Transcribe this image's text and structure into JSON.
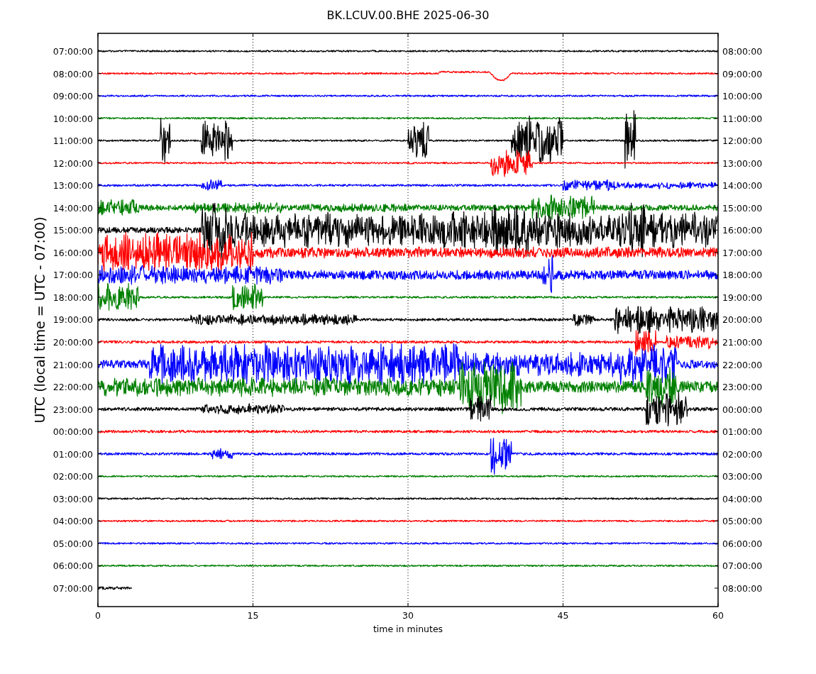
{
  "title": "BK.LCUV.00.BHE 2025-06-30",
  "ylabel": "UTC (local time = UTC - 07:00)",
  "xlabel": "time in minutes",
  "xticks": [
    "0",
    "15",
    "30",
    "45",
    "60"
  ],
  "traces": [
    {
      "left_label": "07:00:00",
      "right_label": "08:00:00",
      "color": "#000000",
      "level": 1
    },
    {
      "left_label": "08:00:00",
      "right_label": "09:00:00",
      "color": "#ff0000",
      "level": 1
    },
    {
      "left_label": "09:00:00",
      "right_label": "10:00:00",
      "color": "#0000ff",
      "level": 1
    },
    {
      "left_label": "10:00:00",
      "right_label": "11:00:00",
      "color": "#008000",
      "level": 1
    },
    {
      "left_label": "11:00:00",
      "right_label": "12:00:00",
      "color": "#000000",
      "level": 1
    },
    {
      "left_label": "12:00:00",
      "right_label": "13:00:00",
      "color": "#ff0000",
      "level": 1
    },
    {
      "left_label": "13:00:00",
      "right_label": "14:00:00",
      "color": "#0000ff",
      "level": 1
    },
    {
      "left_label": "14:00:00",
      "right_label": "15:00:00",
      "color": "#008000",
      "level": 1
    },
    {
      "left_label": "15:00:00",
      "right_label": "16:00:00",
      "color": "#000000",
      "level": 1
    },
    {
      "left_label": "16:00:00",
      "right_label": "17:00:00",
      "color": "#ff0000",
      "level": 1
    },
    {
      "left_label": "17:00:00",
      "right_label": "18:00:00",
      "color": "#0000ff",
      "level": 1
    },
    {
      "left_label": "18:00:00",
      "right_label": "19:00:00",
      "color": "#008000",
      "level": 1
    },
    {
      "left_label": "19:00:00",
      "right_label": "20:00:00",
      "color": "#000000",
      "level": 1
    },
    {
      "left_label": "20:00:00",
      "right_label": "21:00:00",
      "color": "#ff0000",
      "level": 1
    },
    {
      "left_label": "21:00:00",
      "right_label": "22:00:00",
      "color": "#0000ff",
      "level": 1
    },
    {
      "left_label": "22:00:00",
      "right_label": "23:00:00",
      "color": "#008000",
      "level": 1
    },
    {
      "left_label": "23:00:00",
      "right_label": "00:00:00",
      "color": "#000000",
      "level": 1
    },
    {
      "left_label": "00:00:00",
      "right_label": "01:00:00",
      "color": "#ff0000",
      "level": 1
    },
    {
      "left_label": "01:00:00",
      "right_label": "02:00:00",
      "color": "#0000ff",
      "level": 1
    },
    {
      "left_label": "02:00:00",
      "right_label": "03:00:00",
      "color": "#008000",
      "level": 1
    },
    {
      "left_label": "03:00:00",
      "right_label": "04:00:00",
      "color": "#000000",
      "level": 1
    },
    {
      "left_label": "04:00:00",
      "right_label": "05:00:00",
      "color": "#ff0000",
      "level": 1
    },
    {
      "left_label": "05:00:00",
      "right_label": "06:00:00",
      "color": "#0000ff",
      "level": 1
    },
    {
      "left_label": "06:00:00",
      "right_label": "07:00:00",
      "color": "#008000",
      "level": 1
    },
    {
      "left_label": "07:00:00",
      "right_label": "08:00:00",
      "color": "#000000",
      "level": 0.055
    }
  ]
}
